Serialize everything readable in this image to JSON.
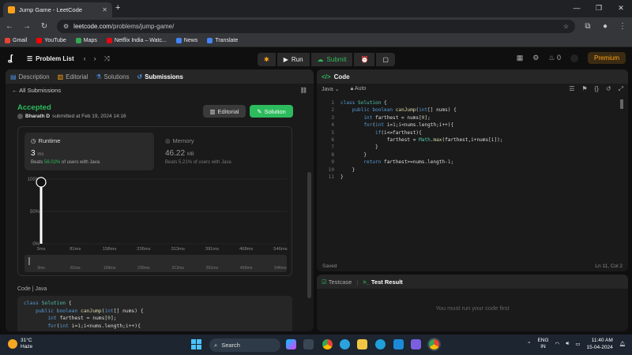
{
  "browser": {
    "tab_title": "Jump Game - LeetCode",
    "url_host": "leetcode.com",
    "url_path": "/problems/jump-game/",
    "bookmarks": [
      {
        "label": "Gmail",
        "color": "#ea4335"
      },
      {
        "label": "YouTube",
        "color": "#ff0000"
      },
      {
        "label": "Maps",
        "color": "#34a853"
      },
      {
        "label": "Netflix India – Watc...",
        "color": "#e50914"
      },
      {
        "label": "News",
        "color": "#4285f4"
      },
      {
        "label": "Translate",
        "color": "#4285f4"
      }
    ]
  },
  "nav": {
    "problem_list": "Problem List",
    "run": "Run",
    "submit": "Submit",
    "streak": "0",
    "premium": "Premium"
  },
  "left": {
    "tabs": [
      "Description",
      "Editorial",
      "Solutions",
      "Submissions"
    ],
    "all_submissions": "All Submissions",
    "status": "Accepted",
    "user": "Bharath D",
    "submitted_at": "submitted at Feb 19, 2024 14:16",
    "editorial_btn": "Editorial",
    "solution_btn": "Solution",
    "runtime": {
      "title": "Runtime",
      "value": "3",
      "unit": "ms",
      "beats_prefix": "Beats",
      "beats_pct": "56.02%",
      "beats_suffix": "of users with Java"
    },
    "memory": {
      "title": "Memory",
      "value": "46.22",
      "unit": "MB",
      "beats_text": "Beats 5.21% of users with Java"
    },
    "code_label": "Code",
    "code_lang": "Java"
  },
  "chart_data": {
    "type": "bar",
    "categories": [
      "3ms",
      "81ms",
      "158ms",
      "236ms",
      "313ms",
      "391ms",
      "468ms",
      "546ms"
    ],
    "values": [
      100,
      0,
      0,
      0,
      0,
      0,
      0,
      0
    ],
    "yticks": [
      "100%",
      "50%",
      "0%"
    ],
    "ylim": [
      0,
      100
    ],
    "selected": "3ms",
    "brush_labels": [
      "3ms",
      "81ms",
      "158ms",
      "236ms",
      "313ms",
      "391ms",
      "468ms",
      "546ms"
    ]
  },
  "code_panel": {
    "title": "Code",
    "language": "Java",
    "mode": "Auto",
    "line_numbers": [
      "1",
      "2",
      "3",
      "4",
      "5",
      "6",
      "7",
      "8",
      "9",
      "10",
      "11"
    ],
    "saved": "Saved",
    "cursor": "Ln 11, Col 2"
  },
  "test_panel": {
    "testcase": "Testcase",
    "result": "Test Result",
    "message": "You must run your code first"
  },
  "taskbar": {
    "temp": "31°C",
    "weather": "Haze",
    "search": "Search",
    "lang1": "ENG",
    "lang2": "IN",
    "time": "11:40 AM",
    "date": "15-04-2024"
  }
}
